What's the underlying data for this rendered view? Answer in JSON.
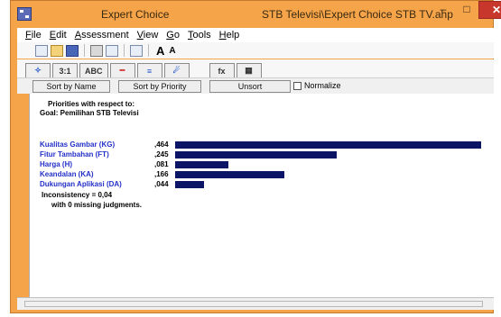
{
  "window": {
    "app_title": "Expert Choice",
    "doc_title": "STB Televisi\\Expert Choice STB TV.ahp",
    "minimize": "–",
    "maximize": "□",
    "close": "✕"
  },
  "menu": [
    {
      "pre": "",
      "u": "F",
      "post": "ile"
    },
    {
      "pre": "",
      "u": "E",
      "post": "dit"
    },
    {
      "pre": "",
      "u": "A",
      "post": "ssessment"
    },
    {
      "pre": "",
      "u": "V",
      "post": "iew"
    },
    {
      "pre": "",
      "u": "G",
      "post": "o"
    },
    {
      "pre": "",
      "u": "T",
      "post": "ools"
    },
    {
      "pre": "",
      "u": "H",
      "post": "elp"
    }
  ],
  "toolbar": {
    "font_big": "A",
    "font_small": "A",
    "icons": [
      "new-icon",
      "open-icon",
      "save-icon",
      "print-icon",
      "print-preview-icon",
      "tree-icon",
      "font-increase-icon",
      "font-decrease-icon"
    ]
  },
  "tabs": [
    {
      "name": "tab-tree-view",
      "label": "✧"
    },
    {
      "name": "tab-pairwise-numerical",
      "label": "3:1"
    },
    {
      "name": "tab-pairwise-verbal",
      "label": "ABC"
    },
    {
      "name": "tab-pairwise-graphical",
      "label": "━"
    },
    {
      "name": "tab-priorities",
      "label": "≡"
    },
    {
      "name": "tab-sensitivity",
      "label": "☄"
    },
    {
      "name": "tab-formula",
      "label": "fx"
    },
    {
      "name": "tab-data-grid",
      "label": "▦"
    }
  ],
  "buttons": {
    "sort_by_name": "Sort by Name",
    "sort_by_priority": "Sort by Priority",
    "unsort": "Unsort",
    "normalize": "Normalize"
  },
  "report": {
    "heading": "Priorities with respect to:",
    "goal": "Goal: Pemilihan STB Televisi",
    "inconsistency": "Inconsistency = 0,04",
    "missing": "with 0  missing judgments."
  },
  "chart_data": {
    "type": "bar",
    "orientation": "horizontal",
    "categories": [
      "Kualitas Gambar (KG)",
      "Fitur Tambahan (FT)",
      "Harga (H)",
      "Keandalan (KA)",
      "Dukungan Aplikasi (DA)"
    ],
    "values": [
      0.464,
      0.245,
      0.081,
      0.166,
      0.044
    ],
    "value_labels": [
      ",464",
      ",245",
      ",081",
      ",166",
      ",044"
    ],
    "bar_color": "#0c1466",
    "label_color": "#2330c8"
  }
}
